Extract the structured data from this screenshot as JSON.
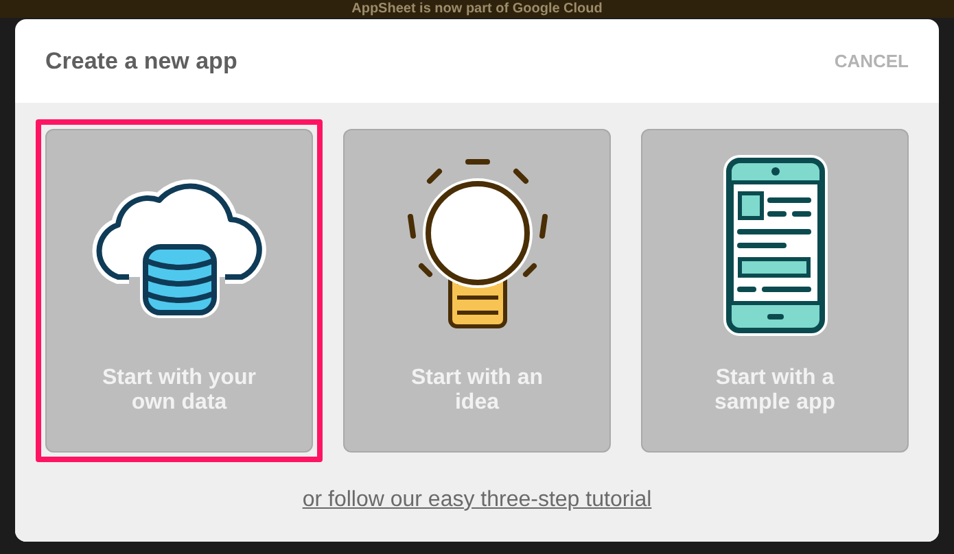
{
  "banner": {
    "text": "AppSheet is now part of Google Cloud"
  },
  "dialog": {
    "title": "Create a new app",
    "cancel": "CANCEL"
  },
  "options": [
    {
      "kind": "data",
      "label": "Start with your own data",
      "selected": true
    },
    {
      "kind": "idea",
      "label": "Start with an idea",
      "selected": false
    },
    {
      "kind": "sample",
      "label": "Start with a sample app",
      "selected": false
    }
  ],
  "tutorial_link": "or follow our easy three-step tutorial"
}
